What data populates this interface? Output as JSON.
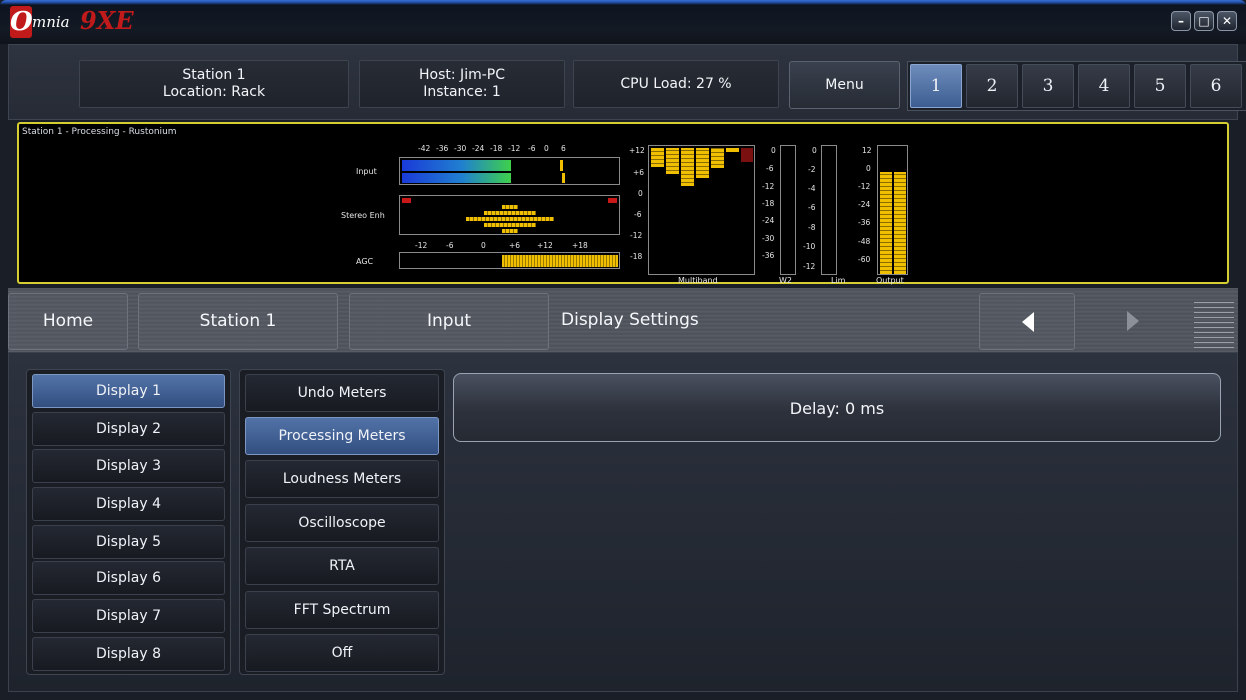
{
  "app": {
    "logo_letter": "O",
    "logo_text": "mnia",
    "logo_suffix": "9XE"
  },
  "window_controls": {
    "minimize": "–",
    "maximize": "□",
    "close": "✕"
  },
  "status": {
    "station_line1": "Station 1",
    "station_line2": "Location: Rack",
    "host_line1": "Host: Jim-PC",
    "host_line2": "Instance: 1",
    "cpu": "CPU Load: 27 %",
    "menu_label": "Menu",
    "instances": [
      "1",
      "2",
      "3",
      "4",
      "5",
      "6"
    ],
    "active_instance": "1"
  },
  "meters": {
    "title": "Station 1 - Processing - Rustonium",
    "input_label": "Input",
    "stereo_label": "Stereo Enh",
    "agc_label": "AGC",
    "input_scale": [
      "-42",
      "-36",
      "-30",
      "-24",
      "-18",
      "-12",
      "-6",
      "0",
      "6"
    ],
    "agc_scale": [
      "-12",
      "-6",
      "0",
      "+6",
      "+12",
      "+18"
    ],
    "multiband_scale": [
      "+12",
      "+6",
      "0",
      "-6",
      "-12",
      "-18"
    ],
    "w2_scale": [
      "0",
      "-6",
      "-12",
      "-18",
      "-24",
      "-30",
      "-36"
    ],
    "lim_scale": [
      "0",
      "-2",
      "-4",
      "-6",
      "-8",
      "-10",
      "-12"
    ],
    "output_scale": [
      "12",
      "0",
      "-12",
      "-24",
      "-36",
      "-48",
      "-60"
    ],
    "multiband_label": "Multiband",
    "w2_label": "W2",
    "lim_label": "Lim",
    "output_label": "Output",
    "colors": {
      "border": "#d6cd32",
      "yellow": "#f0c000",
      "red": "#c81818",
      "green": "#3ed04a",
      "blue": "#1a3ad8"
    }
  },
  "nav": {
    "home": "Home",
    "station": "Station 1",
    "input": "Input",
    "current": "Display Settings",
    "back_icon": "left-arrow-icon",
    "forward_icon": "right-arrow-icon"
  },
  "displays": [
    "Display 1",
    "Display 2",
    "Display 3",
    "Display 4",
    "Display 5",
    "Display 6",
    "Display 7",
    "Display 8"
  ],
  "active_display": "Display 1",
  "options": [
    "Undo Meters",
    "Processing Meters",
    "Loudness Meters",
    "Oscilloscope",
    "RTA",
    "FFT Spectrum",
    "Off"
  ],
  "active_option": "Processing Meters",
  "delay_label": "Delay: 0 ms"
}
